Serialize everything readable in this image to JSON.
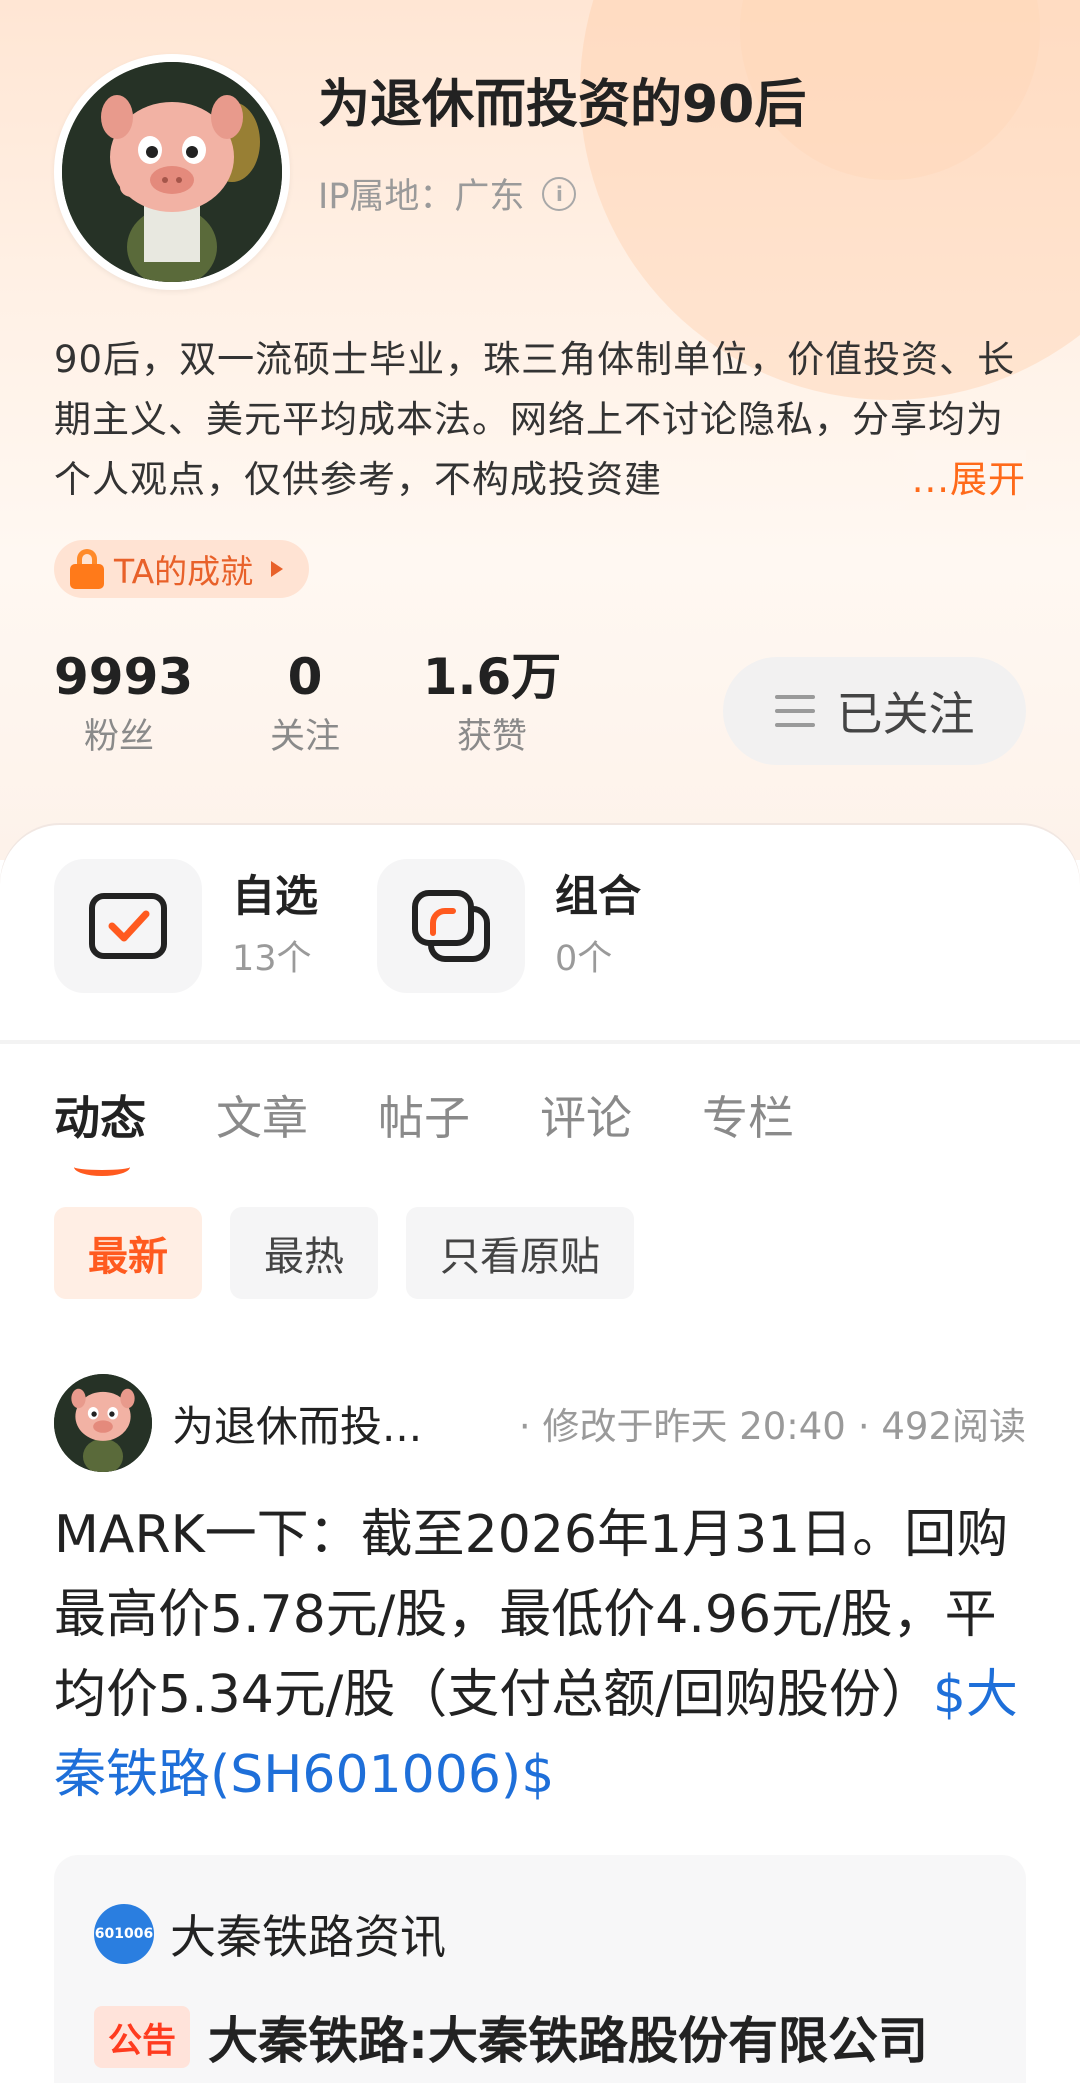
{
  "profile": {
    "name": "为退休而投资的90后",
    "ip_location": "IP属地：广东",
    "bio": "90后，双一流硕士毕业，珠三角体制单位，价值投资、长期主义、美元平均成本法。网络上不讨论隐私，分享均为个人观点，仅供参考，不构成投资建",
    "bio_expand": "...展开",
    "achievement_label": "TA的成就",
    "stats": [
      {
        "value": "9993",
        "label": "粉丝"
      },
      {
        "value": "0",
        "label": "关注"
      },
      {
        "value": "1.6万",
        "label": "获赞"
      }
    ],
    "follow_button": "已关注"
  },
  "quick_links": [
    {
      "title": "自选",
      "subtitle": "13个",
      "icon": "watchlist-check-icon"
    },
    {
      "title": "组合",
      "subtitle": "0个",
      "icon": "portfolio-icon"
    }
  ],
  "tabs": [
    "动态",
    "文章",
    "帖子",
    "评论",
    "专栏"
  ],
  "active_tab": "动态",
  "filters": [
    "最新",
    "最热",
    "只看原贴"
  ],
  "active_filter": "最新",
  "post": {
    "author": "为退休而投...",
    "edited": "· 修改于昨天 20:40",
    "reads": "· 492阅读",
    "text": "MARK一下：截至2026年1月31日。回购最高价5.78元/股，最低价4.96元/股，平均价5.34元/股（支付总额/回购股份）",
    "stock_link": "$大秦铁路(SH601006)$",
    "news_card": {
      "source_logo": "601006",
      "source_name": "大秦铁路资讯",
      "tag": "公告",
      "title": "大秦铁路:大秦铁路股份有限公司"
    }
  },
  "colors": {
    "accent": "#ff5a1f",
    "link": "#1e6fd9",
    "hero_bg": "#ffe6d4"
  }
}
